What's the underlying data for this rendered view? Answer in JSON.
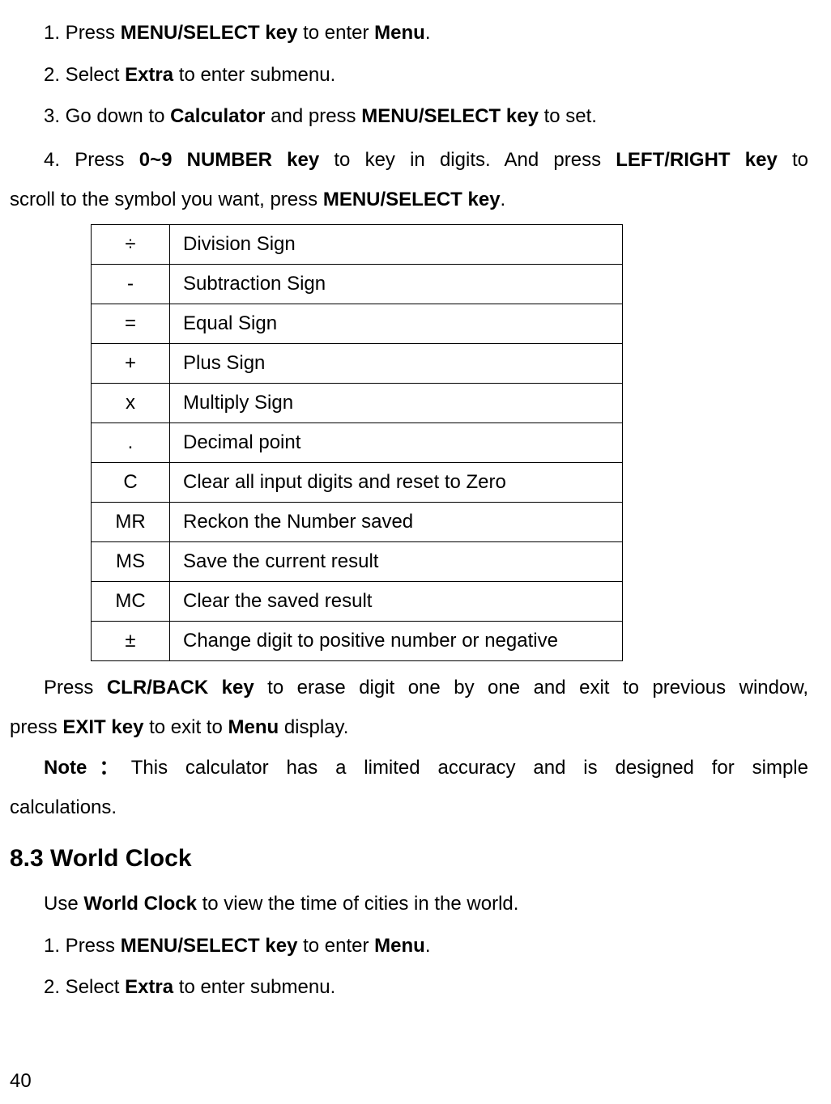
{
  "steps_top": {
    "s1_pre": "1. Press ",
    "s1_b1": "MENU/SELECT key",
    "s1_mid": " to enter ",
    "s1_b2": "Menu",
    "s1_post": ".",
    "s2_pre": "2. Select ",
    "s2_b1": "Extra",
    "s2_post": " to enter submenu.",
    "s3_pre": "3. Go down to ",
    "s3_b1": "Calculator",
    "s3_mid": " and press ",
    "s3_b2": "MENU/SELECT key",
    "s3_post": " to set.",
    "s4_pre": "4. Press ",
    "s4_b1": "0~9 NUMBER key",
    "s4_mid": " to key in digits. And press ",
    "s4_b2": "LEFT/RIGHT key",
    "s4_post": " to",
    "s4_cont_pre": "scroll to the symbol you want, press ",
    "s4_cont_b": "MENU/SELECT key",
    "s4_cont_post": "."
  },
  "table": {
    "rows": [
      {
        "sym": "÷",
        "desc": "Division Sign"
      },
      {
        "sym": "-",
        "desc": "Subtraction Sign"
      },
      {
        "sym": "=",
        "desc": "Equal Sign"
      },
      {
        "sym": "+",
        "desc": "Plus Sign"
      },
      {
        "sym": "x",
        "desc": "Multiply Sign"
      },
      {
        "sym": ".",
        "desc": "Decimal point"
      },
      {
        "sym": "C",
        "desc": "Clear all input digits and reset to Zero"
      },
      {
        "sym": "MR",
        "desc": "Reckon the Number saved"
      },
      {
        "sym": "MS",
        "desc": "Save the current result"
      },
      {
        "sym": "MC",
        "desc": "Clear the saved result"
      },
      {
        "sym": "±",
        "desc": "Change digit to positive number or negative"
      }
    ]
  },
  "after_table": {
    "p1_pre": "Press ",
    "p1_b1": "CLR/BACK key",
    "p1_mid": " to erase digit one by one and exit to previous window,",
    "p1_cont_pre": "press ",
    "p1_cont_b1": "EXIT key",
    "p1_cont_mid": " to exit to ",
    "p1_cont_b2": "Menu",
    "p1_cont_post": " display.",
    "p2_b": "Note：",
    "p2_text": "This calculator has a limited accuracy and is designed for simple",
    "p2_cont": "calculations."
  },
  "section": {
    "heading": "8.3 World Clock",
    "intro_pre": "Use ",
    "intro_b": "World Clock",
    "intro_post": " to view the time of cities in the world.",
    "s1_pre": "1. Press ",
    "s1_b1": "MENU/SELECT key",
    "s1_mid": " to enter ",
    "s1_b2": "Menu",
    "s1_post": ".",
    "s2_pre": "2. Select ",
    "s2_b1": "Extra",
    "s2_post": " to enter submenu."
  },
  "page_number": "40"
}
